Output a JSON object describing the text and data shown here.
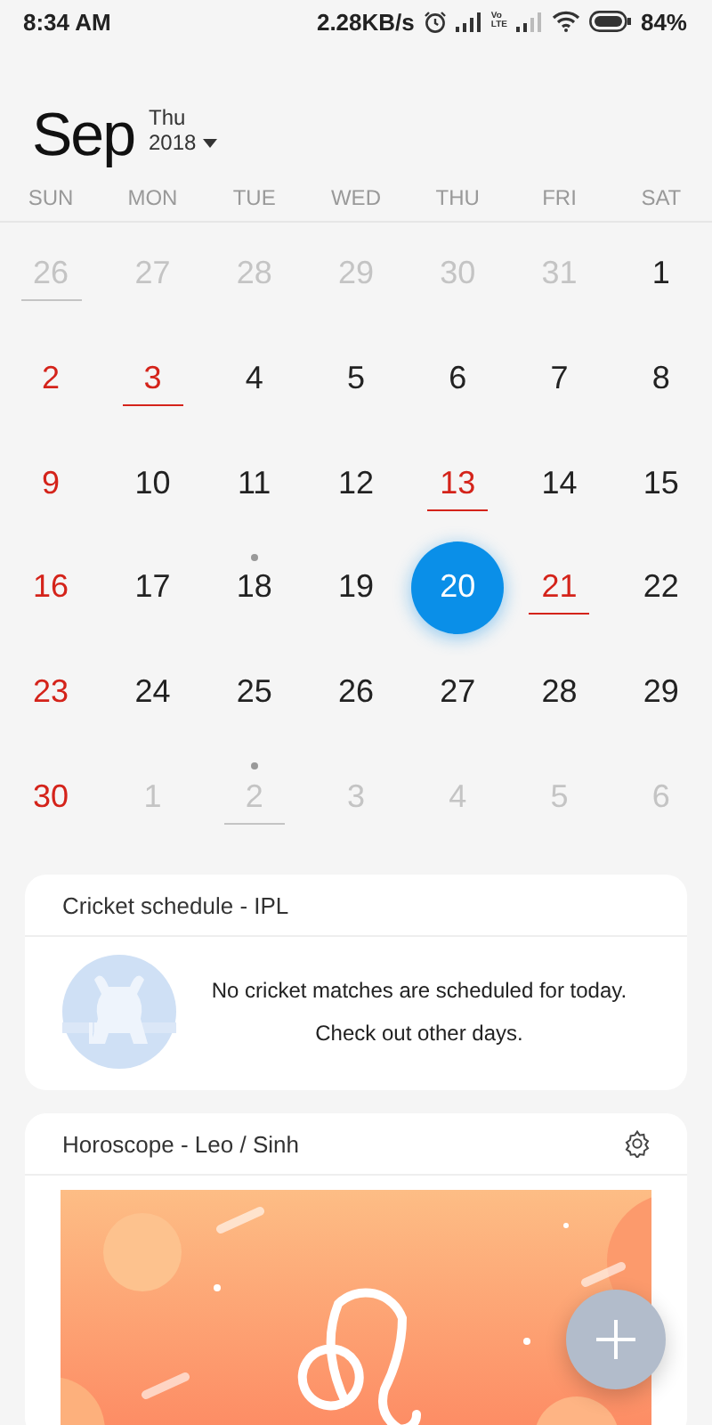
{
  "status_bar": {
    "time": "8:34 AM",
    "speed": "2.28KB/s",
    "volte_top": "Vo",
    "volte_bottom": "LTE",
    "battery": "84%"
  },
  "header": {
    "month": "Sep",
    "weekday": "Thu",
    "year": "2018"
  },
  "weekdays": [
    "SUN",
    "MON",
    "TUE",
    "WED",
    "THU",
    "FRI",
    "SAT"
  ],
  "weeks": [
    [
      {
        "label": "26",
        "muted": true,
        "red": false,
        "underlined": true,
        "dot": false,
        "selected": false
      },
      {
        "label": "27",
        "muted": true,
        "red": false,
        "underlined": false,
        "dot": false,
        "selected": false
      },
      {
        "label": "28",
        "muted": true,
        "red": false,
        "underlined": false,
        "dot": false,
        "selected": false
      },
      {
        "label": "29",
        "muted": true,
        "red": false,
        "underlined": false,
        "dot": false,
        "selected": false
      },
      {
        "label": "30",
        "muted": true,
        "red": false,
        "underlined": false,
        "dot": false,
        "selected": false
      },
      {
        "label": "31",
        "muted": true,
        "red": false,
        "underlined": false,
        "dot": false,
        "selected": false
      },
      {
        "label": "1",
        "muted": false,
        "red": false,
        "underlined": false,
        "dot": false,
        "selected": false
      }
    ],
    [
      {
        "label": "2",
        "muted": false,
        "red": true,
        "underlined": false,
        "dot": false,
        "selected": false
      },
      {
        "label": "3",
        "muted": false,
        "red": true,
        "underlined": true,
        "dot": false,
        "selected": false
      },
      {
        "label": "4",
        "muted": false,
        "red": false,
        "underlined": false,
        "dot": false,
        "selected": false
      },
      {
        "label": "5",
        "muted": false,
        "red": false,
        "underlined": false,
        "dot": false,
        "selected": false
      },
      {
        "label": "6",
        "muted": false,
        "red": false,
        "underlined": false,
        "dot": false,
        "selected": false
      },
      {
        "label": "7",
        "muted": false,
        "red": false,
        "underlined": false,
        "dot": false,
        "selected": false
      },
      {
        "label": "8",
        "muted": false,
        "red": false,
        "underlined": false,
        "dot": false,
        "selected": false
      }
    ],
    [
      {
        "label": "9",
        "muted": false,
        "red": true,
        "underlined": false,
        "dot": false,
        "selected": false
      },
      {
        "label": "10",
        "muted": false,
        "red": false,
        "underlined": false,
        "dot": false,
        "selected": false
      },
      {
        "label": "11",
        "muted": false,
        "red": false,
        "underlined": false,
        "dot": false,
        "selected": false
      },
      {
        "label": "12",
        "muted": false,
        "red": false,
        "underlined": false,
        "dot": false,
        "selected": false
      },
      {
        "label": "13",
        "muted": false,
        "red": true,
        "underlined": true,
        "dot": false,
        "selected": false
      },
      {
        "label": "14",
        "muted": false,
        "red": false,
        "underlined": false,
        "dot": false,
        "selected": false
      },
      {
        "label": "15",
        "muted": false,
        "red": false,
        "underlined": false,
        "dot": false,
        "selected": false
      }
    ],
    [
      {
        "label": "16",
        "muted": false,
        "red": true,
        "underlined": false,
        "dot": false,
        "selected": false
      },
      {
        "label": "17",
        "muted": false,
        "red": false,
        "underlined": false,
        "dot": false,
        "selected": false
      },
      {
        "label": "18",
        "muted": false,
        "red": false,
        "underlined": false,
        "dot": true,
        "selected": false
      },
      {
        "label": "19",
        "muted": false,
        "red": false,
        "underlined": false,
        "dot": false,
        "selected": false
      },
      {
        "label": "20",
        "muted": false,
        "red": false,
        "underlined": false,
        "dot": false,
        "selected": true
      },
      {
        "label": "21",
        "muted": false,
        "red": true,
        "underlined": true,
        "dot": false,
        "selected": false
      },
      {
        "label": "22",
        "muted": false,
        "red": false,
        "underlined": false,
        "dot": false,
        "selected": false
      }
    ],
    [
      {
        "label": "23",
        "muted": false,
        "red": true,
        "underlined": false,
        "dot": false,
        "selected": false
      },
      {
        "label": "24",
        "muted": false,
        "red": false,
        "underlined": false,
        "dot": false,
        "selected": false
      },
      {
        "label": "25",
        "muted": false,
        "red": false,
        "underlined": false,
        "dot": false,
        "selected": false
      },
      {
        "label": "26",
        "muted": false,
        "red": false,
        "underlined": false,
        "dot": false,
        "selected": false
      },
      {
        "label": "27",
        "muted": false,
        "red": false,
        "underlined": false,
        "dot": false,
        "selected": false
      },
      {
        "label": "28",
        "muted": false,
        "red": false,
        "underlined": false,
        "dot": false,
        "selected": false
      },
      {
        "label": "29",
        "muted": false,
        "red": false,
        "underlined": false,
        "dot": false,
        "selected": false
      }
    ],
    [
      {
        "label": "30",
        "muted": false,
        "red": true,
        "underlined": false,
        "dot": false,
        "selected": false
      },
      {
        "label": "1",
        "muted": true,
        "red": false,
        "underlined": false,
        "dot": false,
        "selected": false
      },
      {
        "label": "2",
        "muted": true,
        "red": false,
        "underlined": true,
        "dot": true,
        "selected": false
      },
      {
        "label": "3",
        "muted": true,
        "red": false,
        "underlined": false,
        "dot": false,
        "selected": false
      },
      {
        "label": "4",
        "muted": true,
        "red": false,
        "underlined": false,
        "dot": false,
        "selected": false
      },
      {
        "label": "5",
        "muted": true,
        "red": false,
        "underlined": false,
        "dot": false,
        "selected": false
      },
      {
        "label": "6",
        "muted": true,
        "red": false,
        "underlined": false,
        "dot": false,
        "selected": false
      }
    ]
  ],
  "cricket_card": {
    "title": "Cricket schedule - IPL",
    "message": "No cricket matches are scheduled for today.",
    "hint": "Check out other days."
  },
  "horoscope_card": {
    "title": "Horoscope - Leo / Sinh"
  }
}
